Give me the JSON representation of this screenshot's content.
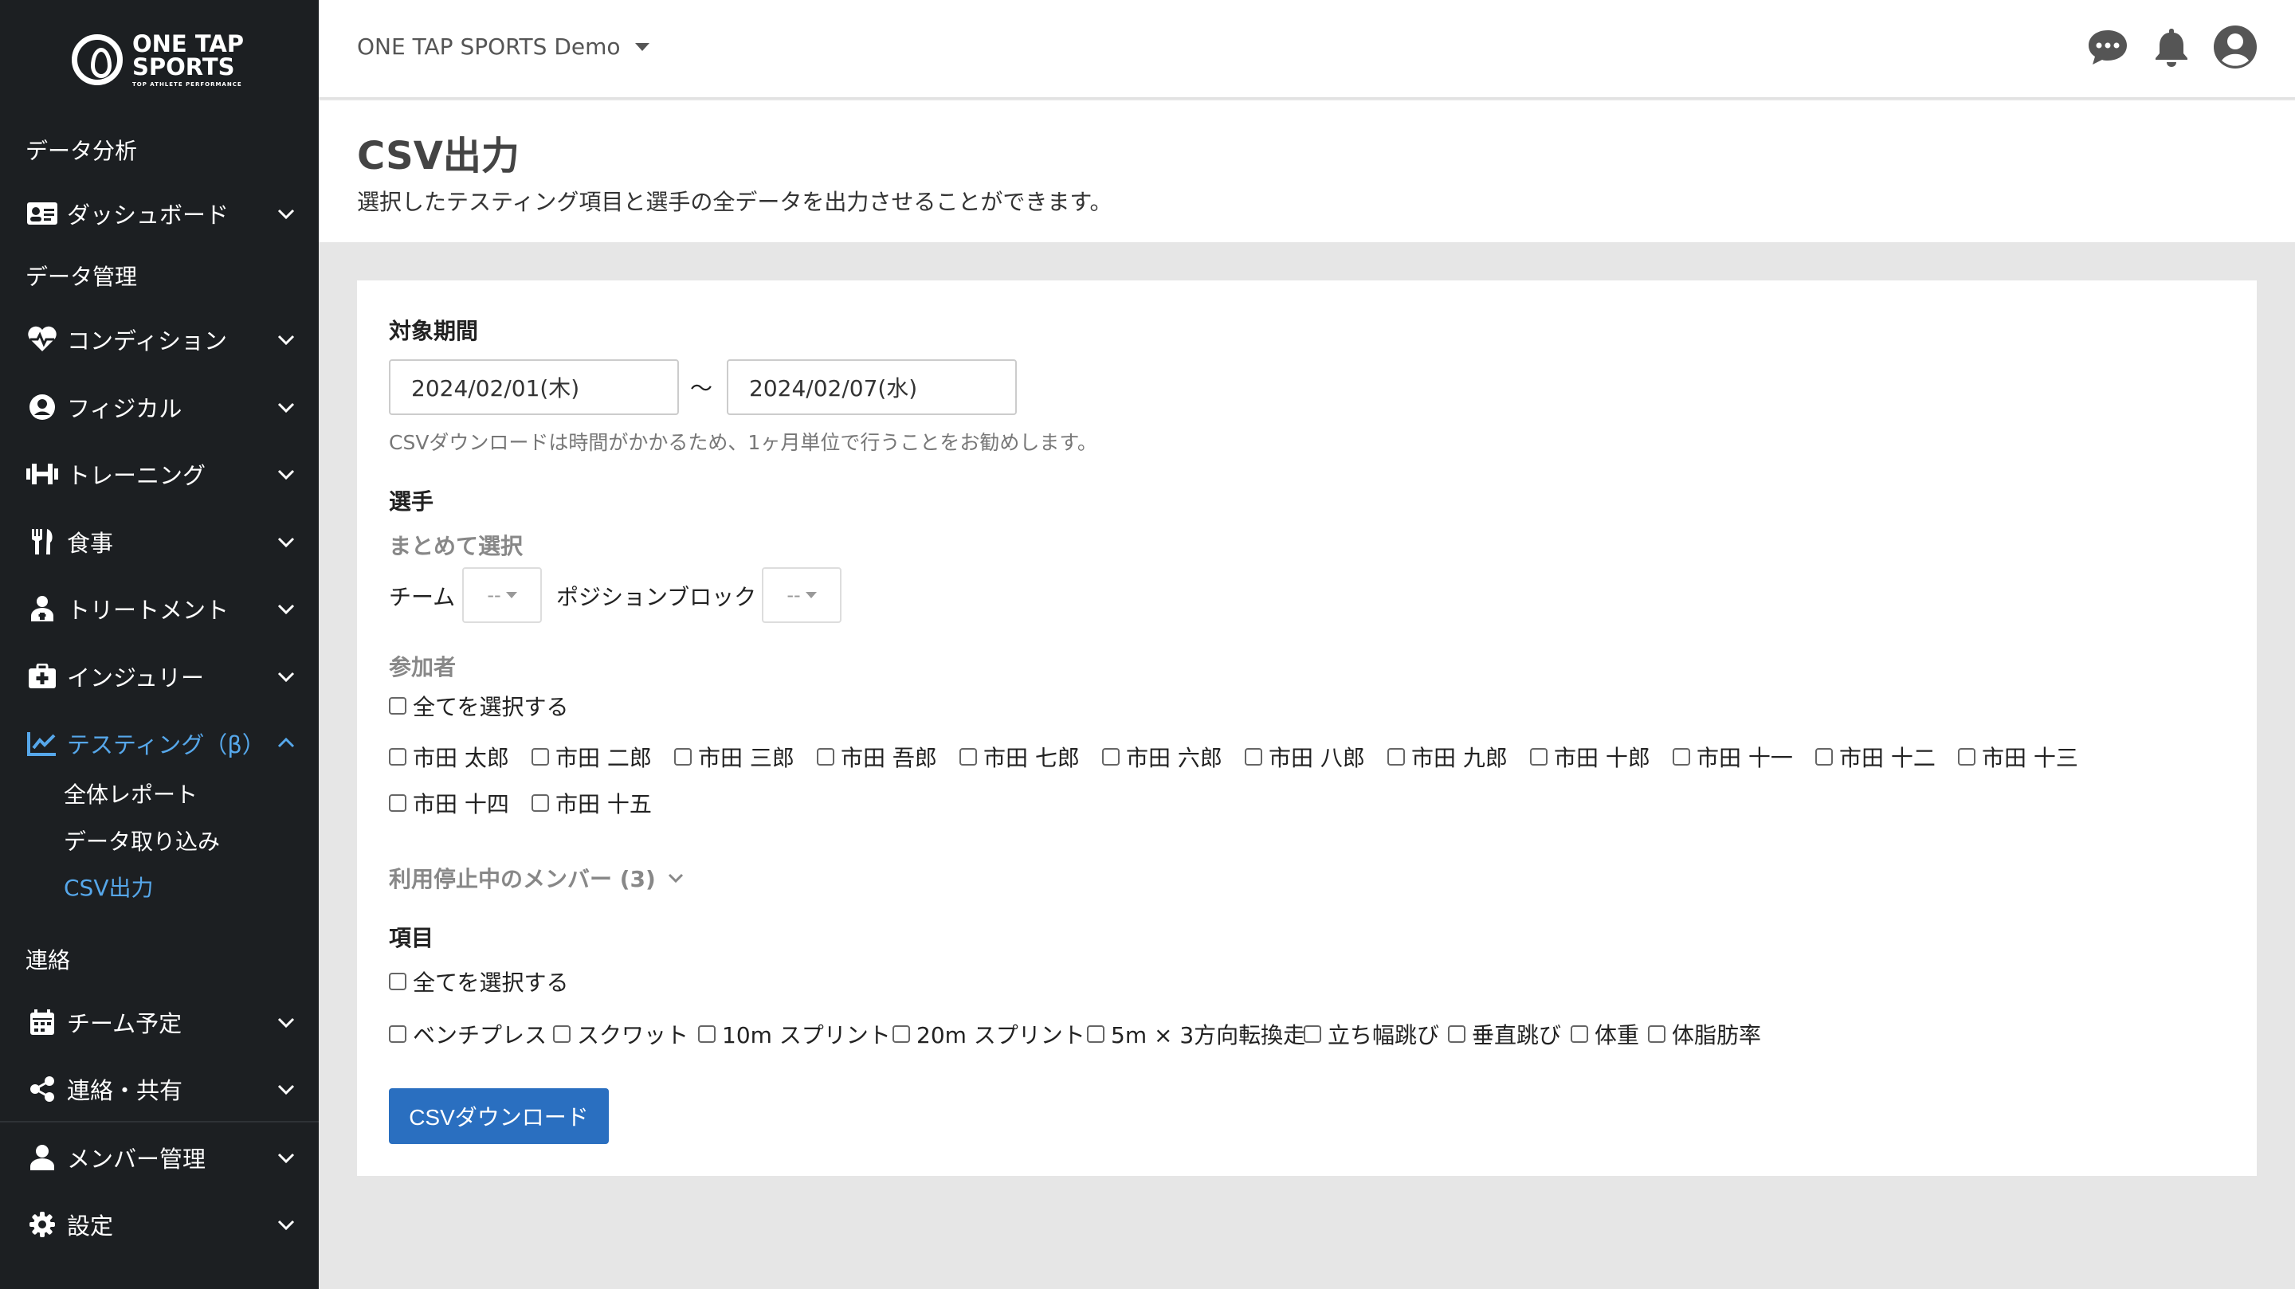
{
  "brand": {
    "line1": "ONE TAP",
    "line2": "SPORTS",
    "tagline": "TOP ATHLETE PERFORMANCE"
  },
  "sidebar": {
    "sections": {
      "analysis": "データ分析",
      "management": "データ管理",
      "contact": "連絡"
    },
    "items": [
      {
        "label": "ダッシュボード",
        "icon": "id-card-icon"
      },
      {
        "label": "コンディション",
        "icon": "heartbeat-icon"
      },
      {
        "label": "フィジカル",
        "icon": "user-circle-icon"
      },
      {
        "label": "トレーニング",
        "icon": "dumbbell-icon"
      },
      {
        "label": "食事",
        "icon": "utensils-icon"
      },
      {
        "label": "トリートメント",
        "icon": "treatment-icon"
      },
      {
        "label": "インジュリー",
        "icon": "first-aid-icon"
      },
      {
        "label": "テスティング（β）",
        "icon": "chart-line-icon"
      },
      {
        "label": "チーム予定",
        "icon": "calendar-icon"
      },
      {
        "label": "連絡・共有",
        "icon": "share-icon"
      },
      {
        "label": "メンバー管理",
        "icon": "user-icon"
      },
      {
        "label": "設定",
        "icon": "gear-icon"
      }
    ],
    "sub": [
      "全体レポート",
      "データ取り込み",
      "CSV出力"
    ]
  },
  "header": {
    "org": "ONE TAP SPORTS Demo"
  },
  "page": {
    "title": "CSV出力",
    "description": "選択したテスティング項目と選手の全データを出力させることができます。"
  },
  "form": {
    "period_label": "対象期間",
    "date_from": "2024/02/01(木)",
    "tilde": "〜",
    "date_to": "2024/02/07(水)",
    "period_hint": "CSVダウンロードは時間がかかるため、1ヶ月単位で行うことをお勧めします。",
    "players_label": "選手",
    "bulk_label": "まとめて選択",
    "team_label": "チーム",
    "team_value": "--",
    "position_label": "ポジションブロック",
    "position_value": "--",
    "participants_label": "参加者",
    "select_all": "全てを選択する",
    "players": [
      "市田 太郎",
      "市田 二郎",
      "市田 三郎",
      "市田 吾郎",
      "市田 七郎",
      "市田 六郎",
      "市田 八郎",
      "市田 九郎",
      "市田 十郎",
      "市田 十一",
      "市田 十二",
      "市田 十三",
      "市田 十四",
      "市田 十五"
    ],
    "inactive_label": "利用停止中のメンバー (3)",
    "items_label": "項目",
    "items": [
      "ベンチプレス",
      "スクワット",
      "10m スプリント",
      "20m スプリント",
      "5m × 3方向転換走",
      "立ち幅跳び",
      "垂直跳び",
      "体重",
      "体脂肪率"
    ],
    "download_button": "CSVダウンロード"
  }
}
